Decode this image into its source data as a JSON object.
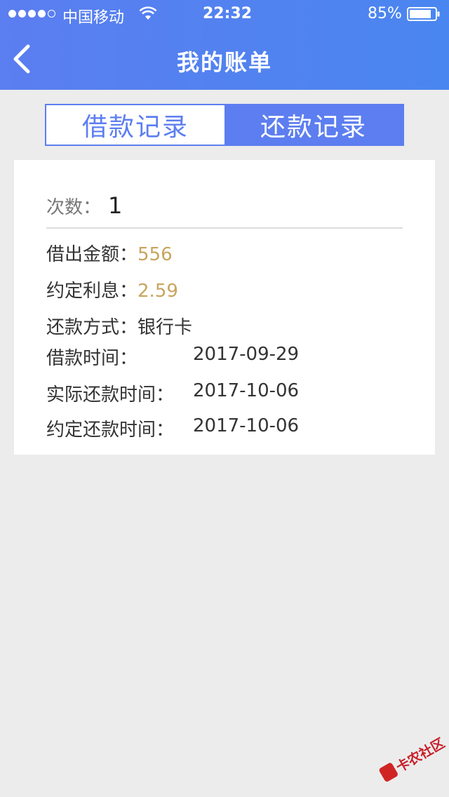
{
  "status_bar": {
    "carrier": "中国移动",
    "time": "22:32",
    "battery": "85%"
  },
  "header": {
    "title": "我的账单"
  },
  "tabs": [
    {
      "label": "借款记录",
      "active": false
    },
    {
      "label": "还款记录",
      "active": true
    }
  ],
  "record": {
    "count_label": "次数：",
    "count_value": "1",
    "amount_label": "借出金额：",
    "amount_value": "556",
    "interest_label": "约定利息：",
    "interest_value": "2.59",
    "method_label": "还款方式：",
    "method_value": "银行卡",
    "loan_time_label": "借款时间：",
    "loan_time_value": "2017-09-29",
    "actual_repay_label": "实际还款时间：",
    "actual_repay_value": "2017-10-06",
    "agreed_repay_label": "约定还款时间：",
    "agreed_repay_value": "2017-10-06"
  },
  "watermark": {
    "text": "卡农社区"
  },
  "colors": {
    "header_blue": "#5b7ef0",
    "tab_blue": "#5d7ef0",
    "gold": "#c8a45e",
    "background": "#ececec"
  }
}
